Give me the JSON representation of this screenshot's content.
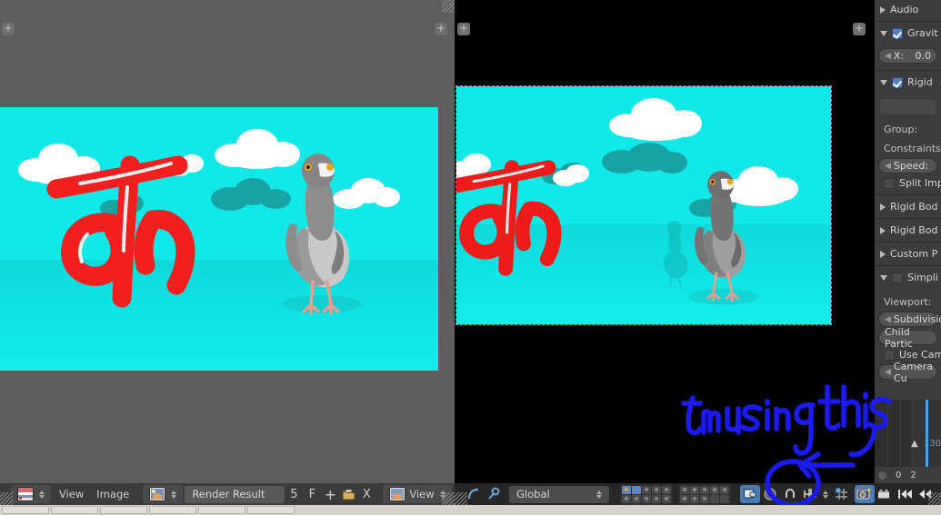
{
  "app": "Blender",
  "left_editor": {
    "name": "image-editor",
    "background_color": "#5d5d5d",
    "add_button": "+",
    "render": {
      "sky_color": "#12e8e8",
      "ground_color": "#10e2e2",
      "sculpture_color": "#f21f1f",
      "sculpture_glyph": "क",
      "cloud_color": "#ffffff",
      "cloud_shadow_color": "#18a3a3",
      "bird": "pigeon"
    }
  },
  "right_editor": {
    "name": "3d-viewport",
    "background_color": "#000000",
    "add_button": "+",
    "render": {
      "sky_color": "#12e8e8",
      "ground_color": "#10e2e2",
      "sculpture_color": "#ee1b1b",
      "sculpture_glyph": "क",
      "bird": "pigeon"
    }
  },
  "properties": {
    "rows": [
      {
        "type": "header",
        "icon": "triangle-right",
        "label": "Audio"
      },
      {
        "type": "header",
        "icon": "triangle-down",
        "checkbox": "on",
        "label": "Gravit"
      },
      {
        "type": "number",
        "label": "X:",
        "value": "0.0"
      },
      {
        "type": "header",
        "icon": "triangle-down",
        "checkbox": "on",
        "label": "Rigid "
      },
      {
        "type": "ghost"
      },
      {
        "type": "label",
        "label": "Group:"
      },
      {
        "type": "label",
        "label": "Constraints:"
      },
      {
        "type": "number",
        "label": "Speed:",
        "value": ""
      },
      {
        "type": "checkbox",
        "checkbox": "off",
        "label": "Split Imp"
      },
      {
        "type": "header",
        "icon": "triangle-right",
        "label": "Rigid Bod"
      },
      {
        "type": "header",
        "icon": "triangle-right",
        "label": "Rigid Bod"
      },
      {
        "type": "header",
        "icon": "triangle-right",
        "label": "Custom P"
      },
      {
        "type": "header",
        "icon": "triangle-down",
        "checkbox": "off",
        "label": "Simpli"
      },
      {
        "type": "label",
        "label": "Viewport:"
      },
      {
        "type": "number",
        "label": "Subdivision",
        "value": ""
      },
      {
        "type": "pill",
        "label": "Child Partic"
      },
      {
        "type": "checkbox",
        "checkbox": "off",
        "label": "Use Cam"
      },
      {
        "type": "number",
        "label": "Camera Cu",
        "value": ""
      }
    ]
  },
  "timeline": {
    "name": "timeline",
    "current_frame": "0",
    "end_label": "130",
    "tick_right": "2",
    "playhead_color": "#4aa3e0"
  },
  "header_left": {
    "editor_type_icon": "image-editor-icon",
    "menus": [
      "View",
      "Image"
    ],
    "datablock_icon": "image-datablock-icon",
    "datablock_name": "Render Result",
    "slot": "5",
    "fake_user": "F",
    "new_button": "+",
    "open_button": "open-folder-icon",
    "unlink_button": "X",
    "view_icon": "image-view-icon",
    "view_label": "View",
    "fullscreen_button": "fullscreen-icon"
  },
  "header_right": {
    "rotate_icon": "rotate-icon",
    "pin_icon": "pin-icon",
    "orientation": "Global",
    "layer_grid_a": [
      true,
      true,
      false,
      false,
      false,
      false,
      false,
      false,
      false,
      false
    ],
    "layer_grid_b": [
      false,
      false,
      false,
      false,
      false,
      false,
      false,
      false,
      false,
      false
    ],
    "buttons": [
      "render-link-icon",
      "shading-mode-icon",
      "snap-magnet-icon",
      "proportional-edit-icon",
      "snap-grid-icon",
      "render-camera-icon",
      "render-animation-icon"
    ],
    "playback": [
      "jump-to-start",
      "rewind",
      "play-reverse",
      "play"
    ]
  },
  "annotation": {
    "text": "Im using this",
    "color": "#1b1bf0",
    "circle_target": "render-camera-icon"
  },
  "taskbar": {
    "items": [
      "",
      "",
      "",
      "",
      "",
      ""
    ]
  }
}
